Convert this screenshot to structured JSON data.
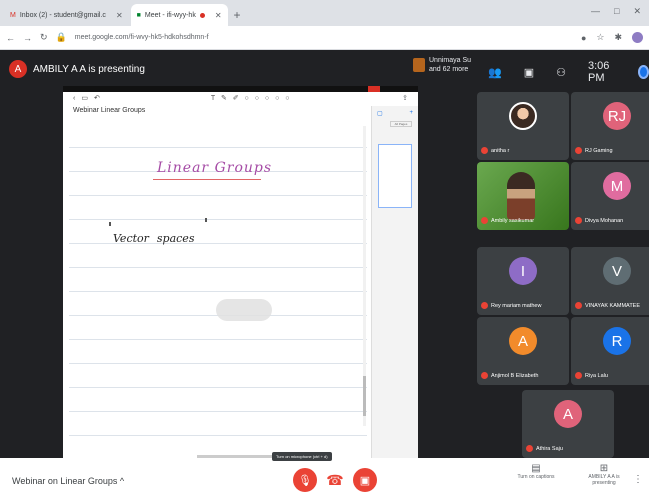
{
  "browser": {
    "tabs": [
      {
        "label": "Inbox (2) - student@gmail.c",
        "active": false
      },
      {
        "label": "Meet - ifi-wyy-hk",
        "active": true
      }
    ],
    "new_tab_icon": "+",
    "url": "meet.google.com/fi-wvy-hk5-hdkohsdhmn-f",
    "window_controls": [
      "—",
      "□",
      "✕"
    ]
  },
  "meet": {
    "presenter_initial": "A",
    "presenting_text": "AMBILY A A is presenting",
    "others_text": "Unnimaya Su and 62 more",
    "clock": "3:06 PM",
    "presentation": {
      "note_title": "Webinar Linear Groups",
      "note_date": "",
      "heading": "Linear Groups",
      "line2_a": "Vector",
      "line2_b": "spaces",
      "side_tab": "All Pages"
    },
    "participants": [
      {
        "name": "anitha r",
        "initial": "",
        "color": "#3c4043",
        "kind": "photo"
      },
      {
        "name": "RJ Gaming",
        "initial": "RJ",
        "color": "#e0637a",
        "kind": "avatar"
      },
      {
        "name": "Ambily sasikumar",
        "initial": "",
        "color": "#6aa84f",
        "kind": "video"
      },
      {
        "name": "Divya Mohanan",
        "initial": "M",
        "color": "#e06c9f",
        "kind": "avatar"
      },
      {
        "name": "Rey mariam mathew",
        "initial": "I",
        "color": "#8e6cc6",
        "kind": "avatar"
      },
      {
        "name": "VINAYAK KAMMATEE",
        "initial": "V",
        "color": "#5f6d73",
        "kind": "avatar"
      },
      {
        "name": "Anjimol B Elizabeth",
        "initial": "A",
        "color": "#f28b2b",
        "kind": "avatar"
      },
      {
        "name": "Riya Lalu",
        "initial": "R",
        "color": "#1a73e8",
        "kind": "avatar"
      },
      {
        "name": "Athira Saju",
        "initial": "A",
        "color": "#e0637a",
        "kind": "avatar"
      }
    ],
    "bottom": {
      "meeting_name": "Webinar on Linear Groups",
      "tooltip": "Turn on microphone (ctrl + d)",
      "turn_on_captions": "Turn on captions",
      "presenting_label": "AMBILY A A is presenting"
    }
  }
}
